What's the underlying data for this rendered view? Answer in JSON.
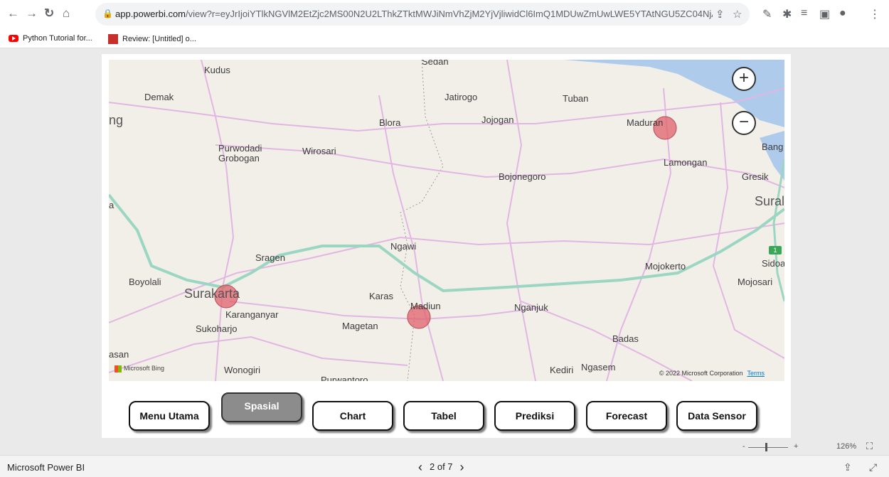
{
  "browser": {
    "url_domain": "app.powerbi.com",
    "url_rest": "/view?r=eyJrIjoiYTlkNGVlM2EtZjc2MS00N2U2LThkZTktMWJiNmVhZjM2YjVjliwidCl6ImQ1MDUwZmUwLWE5YTAtNGU5ZC04NjA4L...",
    "bookmarks": [
      "Python Tutorial for...",
      "Review: [Untitled] o..."
    ]
  },
  "map": {
    "cities": {
      "kudus": "Kudus",
      "demak": "Demak",
      "blora": "Blora",
      "jatirogo": "Jatirogo",
      "tuban": "Tuban",
      "jojogan": "Jojogan",
      "maduran": "Maduran",
      "bang": "Bang",
      "purwodadi": "Purwodadi",
      "grobogan": "Grobogan",
      "wirosari": "Wirosari",
      "lamongan": "Lamongan",
      "bojonegoro": "Bojonegoro",
      "gresik": "Gresik",
      "sural": "Sural",
      "ngawi": "Ngawi",
      "sragen": "Sragen",
      "mojokerto": "Mojokerto",
      "sidoa": "Sidoa",
      "boyolali": "Boyolali",
      "mojosari": "Mojosari",
      "surakarta": "Surakarta",
      "karas": "Karas",
      "madiun": "Madiun",
      "nganjuk": "Nganjuk",
      "karanganyar": "Karanganyar",
      "magetan": "Magetan",
      "sukoharjo": "Sukoharjo",
      "badas": "Badas",
      "wonogiri": "Wonogiri",
      "kediri": "Kediri",
      "ngasem": "Ngasem",
      "purwantoro": "Purwantoro",
      "ng": "ng",
      "sedan": "Sedan",
      "asan": "asan",
      "a": "a"
    },
    "highway_shield": "1",
    "bing_label": "Microsoft Bing",
    "copyright": "© 2022 Microsoft Corporation",
    "terms": "Terms",
    "marker_color": "#e0606a"
  },
  "nav_buttons": {
    "menu_utama": "Menu Utama",
    "spasial": "Spasial",
    "chart": "Chart",
    "tabel": "Tabel",
    "prediksi": "Prediksi",
    "forecast": "Forecast",
    "data_sensor": "Data Sensor"
  },
  "zoom": {
    "minus": "-",
    "plus": "+",
    "level": "126%"
  },
  "status": {
    "brand": "Microsoft Power BI",
    "page": "2 of 7"
  }
}
